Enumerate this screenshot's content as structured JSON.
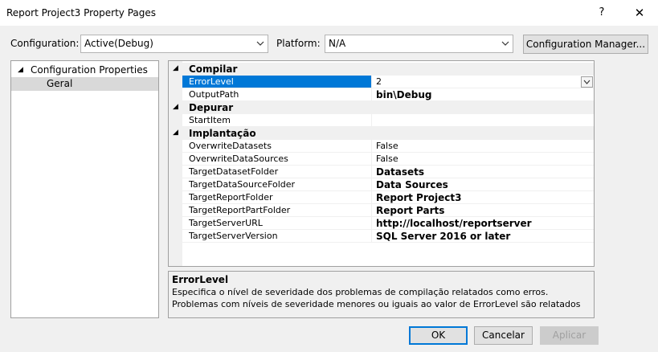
{
  "window": {
    "title": "Report Project3 Property Pages",
    "help_glyph": "?",
    "close_glyph": "✕"
  },
  "toolbar": {
    "configuration_label": "Configuration:",
    "configuration_value": "Active(Debug)",
    "platform_label": "Platform:",
    "platform_value": "N/A",
    "config_manager_label": "Configuration Manager..."
  },
  "tree": {
    "root": "Configuration Properties",
    "child": "Geral"
  },
  "grid": {
    "categories": {
      "compilar": "Compilar",
      "depurar": "Depurar",
      "implantacao": "Implantação"
    },
    "rows": [
      {
        "name": "ErrorLevel",
        "value": "2"
      },
      {
        "name": "OutputPath",
        "value": "bin\\Debug"
      },
      {
        "name": "StartItem",
        "value": ""
      },
      {
        "name": "OverwriteDatasets",
        "value": "False"
      },
      {
        "name": "OverwriteDataSources",
        "value": "False"
      },
      {
        "name": "TargetDatasetFolder",
        "value": "Datasets"
      },
      {
        "name": "TargetDataSourceFolder",
        "value": "Data Sources"
      },
      {
        "name": "TargetReportFolder",
        "value": "Report Project3"
      },
      {
        "name": "TargetReportPartFolder",
        "value": "Report Parts"
      },
      {
        "name": "TargetServerURL",
        "value": "http://localhost/reportserver"
      },
      {
        "name": "TargetServerVersion",
        "value": "SQL Server 2016 or later"
      }
    ]
  },
  "description": {
    "title": "ErrorLevel",
    "text": "Especifica o nível de severidade dos problemas de compilação relatados como erros. Problemas com níveis de severidade menores ou iguais ao valor de ErrorLevel são relatados como erros. Problemas com níveis de..."
  },
  "buttons": {
    "ok": "OK",
    "cancel": "Cancelar",
    "apply": "Aplicar"
  },
  "colors": {
    "selection": "#0078d7",
    "dialog_bg": "#f0f0f0"
  }
}
